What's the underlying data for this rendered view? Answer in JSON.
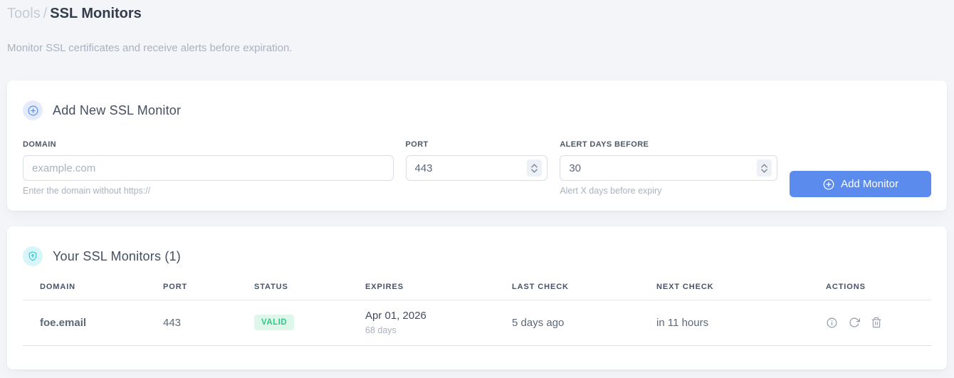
{
  "breadcrumb": {
    "section": "Tools",
    "separator": "/",
    "current": "SSL Monitors"
  },
  "subtitle": "Monitor SSL certificates and receive alerts before expiration.",
  "add_card": {
    "title": "Add New SSL Monitor",
    "fields": {
      "domain": {
        "label": "DOMAIN",
        "placeholder": "example.com",
        "helper": "Enter the domain without https://"
      },
      "port": {
        "label": "PORT",
        "value": "443"
      },
      "alert_days": {
        "label": "ALERT DAYS BEFORE",
        "value": "30",
        "helper": "Alert X days before expiry"
      }
    },
    "submit_label": "Add Monitor"
  },
  "monitors_card": {
    "title": "Your SSL Monitors (1)",
    "table": {
      "headers": [
        "DOMAIN",
        "PORT",
        "STATUS",
        "EXPIRES",
        "LAST CHECK",
        "NEXT CHECK",
        "ACTIONS"
      ],
      "rows": [
        {
          "domain": "foe.email",
          "port": "443",
          "status": "VALID",
          "expires_date": "Apr 01, 2026",
          "expires_in": "68 days",
          "last_check": "5 days ago",
          "next_check": "in 11 hours"
        }
      ]
    }
  },
  "icons": {
    "add_header": "plus-circle-icon",
    "monitors_header": "shield-icon",
    "row_actions": [
      "info-icon",
      "refresh-icon",
      "trash-icon"
    ]
  },
  "colors": {
    "accent_blue": "#5b8bec",
    "accent_cyan": "#29ccd8",
    "status_valid_bg": "#def7ea",
    "status_valid_text": "#30c98a",
    "page_bg": "#f3f5f8"
  }
}
